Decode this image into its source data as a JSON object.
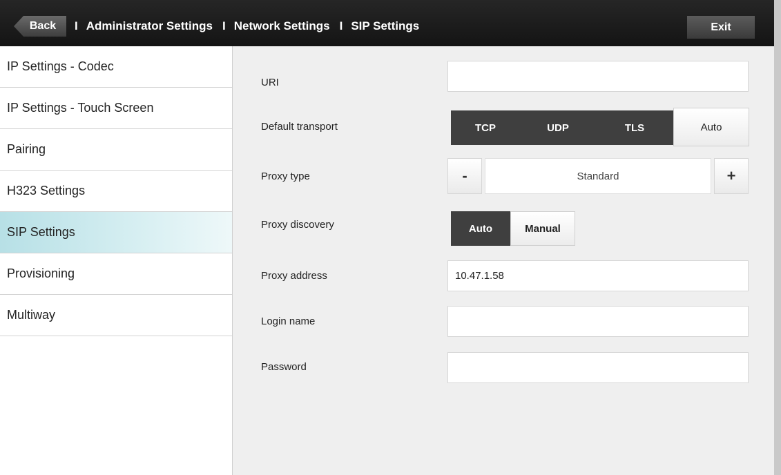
{
  "header": {
    "back_label": "Back",
    "separator": "I",
    "crumbs": [
      "Administrator Settings",
      "Network Settings",
      "SIP Settings"
    ],
    "exit_label": "Exit"
  },
  "sidebar": {
    "items": [
      {
        "label": "IP Settings - Codec"
      },
      {
        "label": "IP Settings - Touch Screen"
      },
      {
        "label": "Pairing"
      },
      {
        "label": "H323 Settings"
      },
      {
        "label": "SIP Settings",
        "active": true
      },
      {
        "label": "Provisioning"
      },
      {
        "label": "Multiway"
      }
    ]
  },
  "form": {
    "uri": {
      "label": "URI",
      "value": ""
    },
    "default_transport": {
      "label": "Default transport",
      "options": [
        "TCP",
        "UDP",
        "TLS",
        "Auto"
      ],
      "selected": "Auto"
    },
    "proxy_type": {
      "label": "Proxy type",
      "minus": "-",
      "value": "Standard",
      "plus": "+"
    },
    "proxy_discovery": {
      "label": "Proxy discovery",
      "options": [
        "Auto",
        "Manual"
      ],
      "selected": "Manual"
    },
    "proxy_address": {
      "label": "Proxy address",
      "value": "10.47.1.58"
    },
    "login_name": {
      "label": "Login name",
      "value": ""
    },
    "password": {
      "label": "Password",
      "value": ""
    }
  },
  "colors": {
    "header_bg": "#1c1c1c",
    "active_item": "#b7e0e6",
    "segment_dark": "#3f3f3f"
  }
}
